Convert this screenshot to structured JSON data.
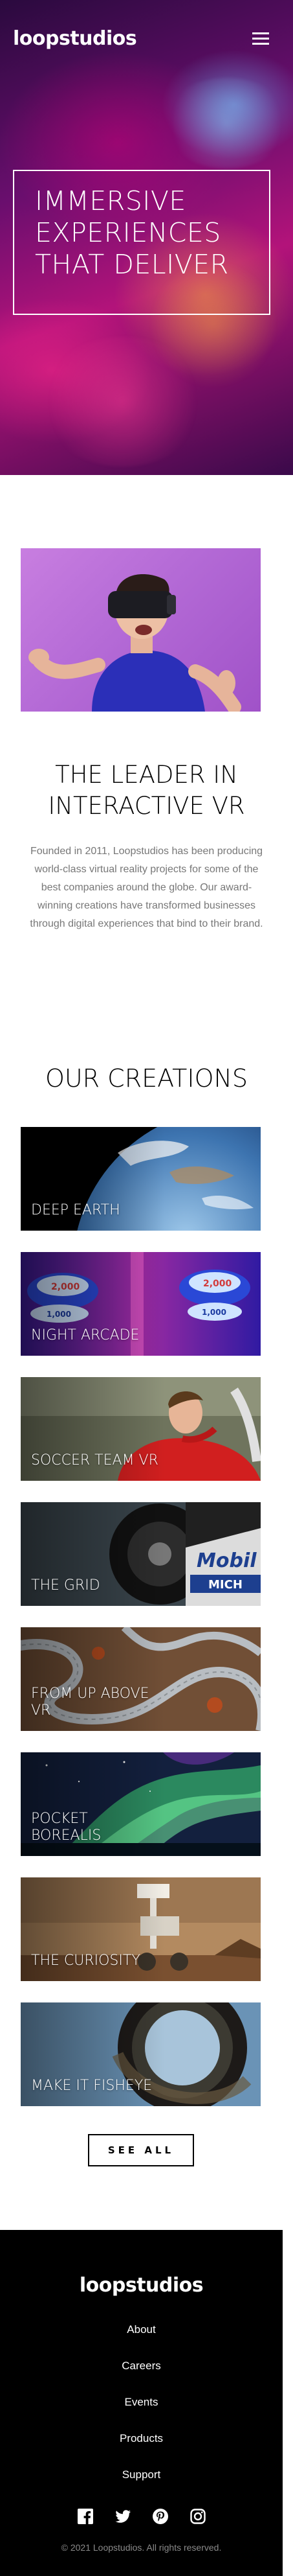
{
  "header": {
    "logo": "loopstudios",
    "menu_icon": "hamburger-icon"
  },
  "hero": {
    "title": "IMMERSIVE EXPERIENCES THAT DELIVER"
  },
  "interactive": {
    "title": "THE LEADER IN INTERACTIVE VR",
    "body": "Founded in 2011, Loopstudios has been producing world-class virtual reality projects for some of the best companies around the globe. Our award-winning creations have transformed businesses through digital experiences that bind to their brand."
  },
  "creations": {
    "title": "OUR CREATIONS",
    "items": [
      {
        "label": "DEEP EARTH"
      },
      {
        "label": "NIGHT ARCADE"
      },
      {
        "label": "SOCCER TEAM VR"
      },
      {
        "label": "THE GRID"
      },
      {
        "label": "FROM UP ABOVE VR"
      },
      {
        "label": "POCKET BOREALIS"
      },
      {
        "label": "THE CURIOSITY"
      },
      {
        "label": "MAKE IT FISHEYE"
      }
    ],
    "see_all": "SEE ALL"
  },
  "footer": {
    "logo": "loopstudios",
    "links": [
      "About",
      "Careers",
      "Events",
      "Products",
      "Support"
    ],
    "socials": [
      "facebook-icon",
      "twitter-icon",
      "pinterest-icon",
      "instagram-icon"
    ],
    "copyright": "© 2021 Loopstudios. All rights reserved."
  }
}
